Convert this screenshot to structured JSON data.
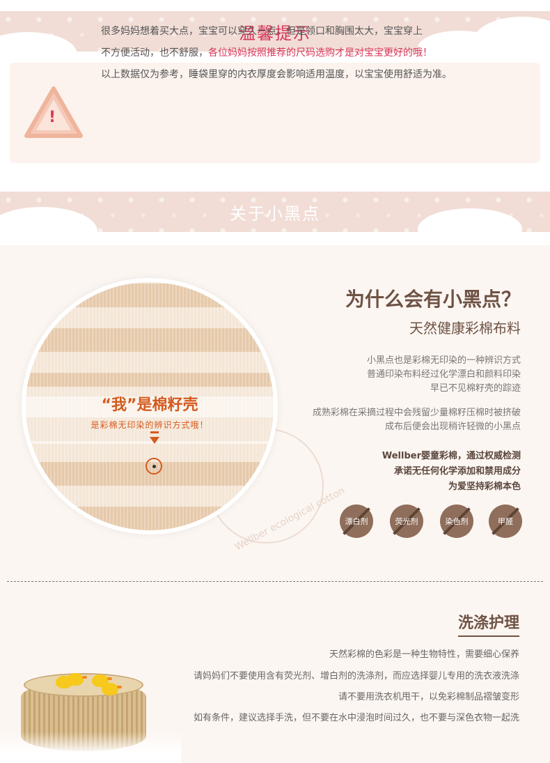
{
  "banner1": {
    "title": "温馨提示"
  },
  "notice": {
    "icon": "warning-triangle-icon",
    "mark": "!",
    "line1": "很多妈妈想着买大点，宝宝可以穿久一点。但是领口和胸围太大，宝宝穿上",
    "line2_prefix": "不方便活动，也不舒服，",
    "line2_highlight": "各位妈妈按照推荐的尺码选购才是对宝宝更好的哦！",
    "line3": "以上数据仅为参考，睡袋里穿的内衣厚度会影响适用温度，以宝宝使用舒适为准。"
  },
  "banner2": {
    "title": "关于小黑点"
  },
  "fabric": {
    "label_main": "“我”是棉籽壳",
    "label_sub": "是彩棉无印染的辨识方式哦！",
    "watermark": "Wellber ecological cotton"
  },
  "dots": {
    "title": "为什么会有小黑点？",
    "subtitle": "天然健康彩棉布料",
    "para1": [
      "小黑点也是彩棉无印染的一种辨识方式",
      "普通印染布料经过化学漂白和颜料印染",
      "早已不见棉籽壳的踪迹"
    ],
    "para2": [
      "成熟彩棉在采摘过程中会残留少量棉籽压棉时被挤破",
      "成布后便会出现稍许轻微的小黑点"
    ],
    "para3": [
      "Wellber婴童彩棉，通过权威检测",
      "承诺无任何化学添加和禁用成分",
      "为爱坚持彩棉本色"
    ],
    "badges": [
      "漂白剂",
      "荧光剂",
      "染色剂",
      "甲醛"
    ]
  },
  "care": {
    "title": "洗涤护理",
    "lines": [
      "天然彩棉的色彩是一种生物特性，需要细心保养",
      "请妈妈们不要使用含有荧光剂、增白剂的洗涤剂，而应选择婴儿专用的洗衣液洗涤",
      "请不要用洗衣机甩干，以免彩棉制品褶皱变形",
      "如有条件，建议选择手洗，但不要在水中浸泡时间过久，也不要与深色衣物一起洗"
    ]
  },
  "colors": {
    "accent_red": "#d8375a",
    "brown": "#6e5244",
    "banner_bg": "#f1ddd6"
  }
}
